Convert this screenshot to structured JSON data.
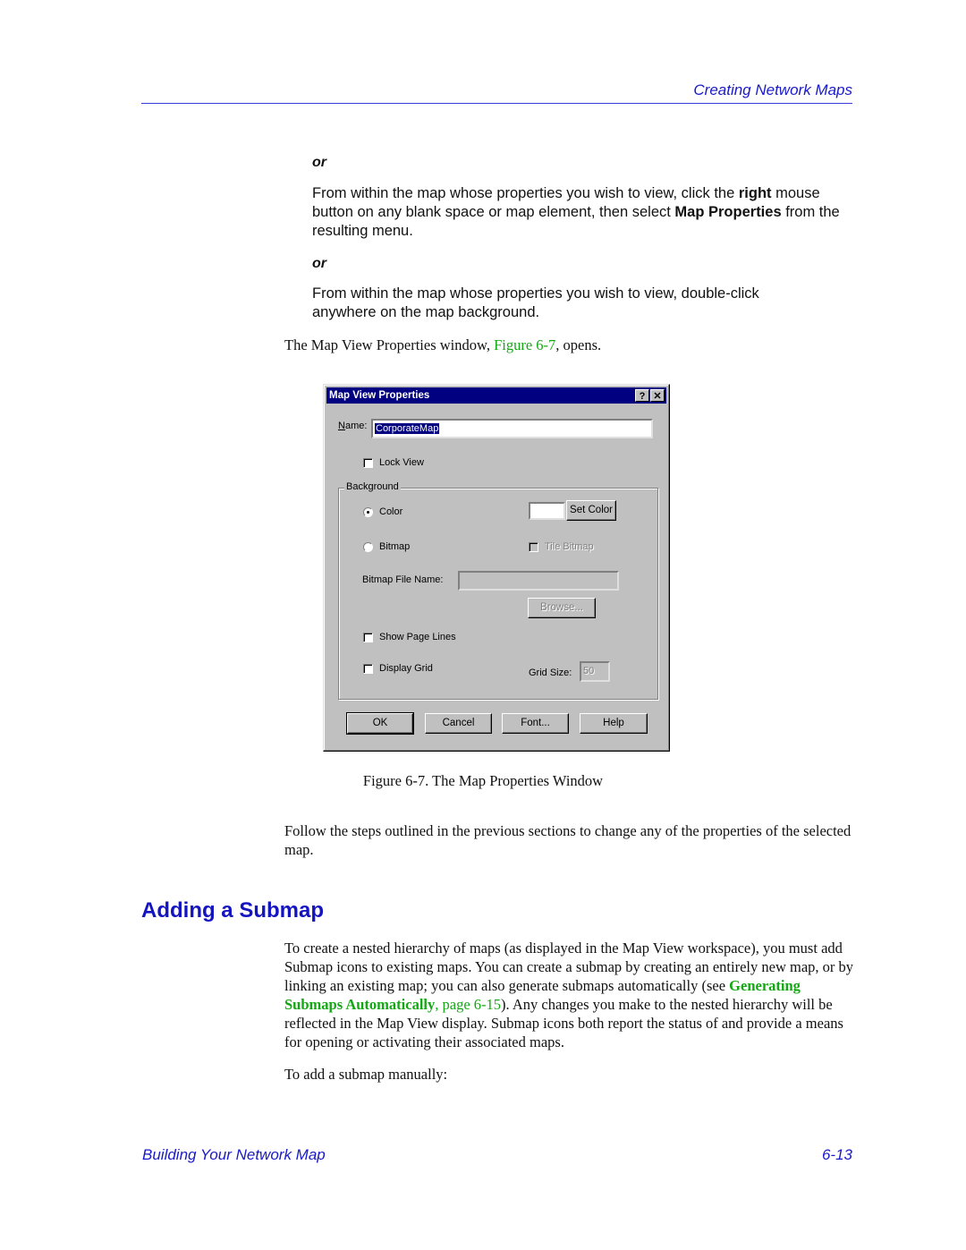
{
  "header": {
    "title": "Creating Network Maps"
  },
  "intro": {
    "or_1": "or",
    "para_1": {
      "before": "From within the map whose properties you wish to view, click the ",
      "bold_1": "right",
      "middle": " mouse button on any blank space or map element, then select ",
      "bold_2": "Map Properties",
      "after": " from the resulting menu."
    },
    "or_2": "or",
    "para_2": "From within the map whose properties you wish to view, double-click anywhere on the map background.",
    "para_3": {
      "before": "The Map View Properties window, ",
      "link": "Figure 6-7",
      "after": ", opens."
    }
  },
  "dialog": {
    "title": "Map View Properties",
    "help_button": "?",
    "close_button": "✕",
    "name_label": "Name:",
    "name_value": "CorporateMap",
    "lock_view_label": "Lock View",
    "lock_view_checked": false,
    "background_group": "Background",
    "color_radio_label": "Color",
    "color_radio_selected": true,
    "color_swatch": "#ffffff",
    "set_color_button": "Set Color",
    "bitmap_radio_label": "Bitmap",
    "bitmap_radio_selected": false,
    "tile_bitmap_label": "Tile Bitmap",
    "tile_bitmap_checked": false,
    "bitmap_file_label": "Bitmap File Name:",
    "bitmap_file_value": "",
    "browse_button": "Browse...",
    "show_page_lines_label": "Show Page Lines",
    "show_page_lines_checked": false,
    "display_grid_label": "Display Grid",
    "display_grid_checked": false,
    "grid_size_label": "Grid Size:",
    "grid_size_value": "50",
    "ok_button": "OK",
    "cancel_button": "Cancel",
    "font_button": "Font...",
    "help_label": "Help"
  },
  "figure_caption": "Figure 6-7.  The Map Properties Window",
  "para_follow": "Follow the steps outlined in the previous sections to change any of the properties of the selected map.",
  "section": {
    "heading": "Adding a Submap",
    "para_1": {
      "before": "To create a nested hierarchy of maps (as displayed in the Map View workspace), you must add Submap icons to existing maps. You can create a submap by creating an entirely new map, or by linking an existing map; you can also generate submaps automatically (see ",
      "link_bold": "Generating Submaps Automatically",
      "link_sep": ", ",
      "link_page": "page 6-15",
      "after": "). Any changes you make to the nested hierarchy will be reflected in the Map View display. Submap icons both report the status of and provide a means for opening or activating their associated maps."
    },
    "para_2": "To add a submap manually:"
  },
  "footer": {
    "left": "Building Your Network Map",
    "right": "6-13"
  },
  "colors": {
    "heading_blue": "#1414c0",
    "link_green": "#13a813",
    "dialog_gray": "#c0c0c0",
    "titlebar_navy": "#000080"
  }
}
